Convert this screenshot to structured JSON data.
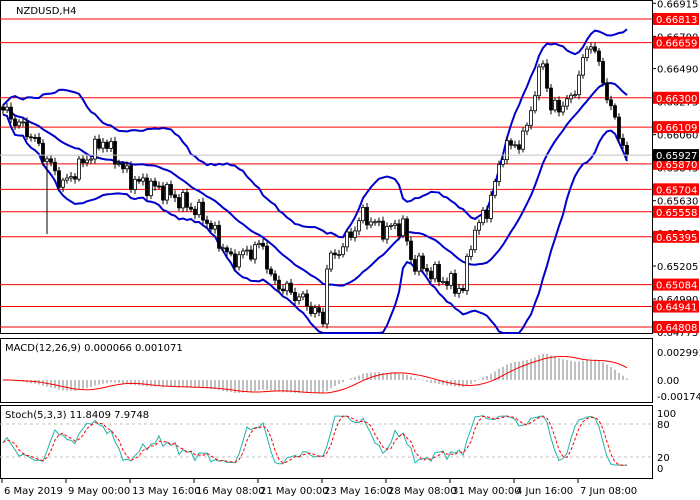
{
  "chart_data": {
    "type": "candlestick",
    "symbol_title": "NZDUSD,H4",
    "ylim": [
      0.64775,
      0.66915
    ],
    "y_ticks": [
      "0.66915",
      "0.66700",
      "0.66490",
      "0.66275",
      "0.66060",
      "0.65845",
      "0.65630",
      "0.65420",
      "0.65205",
      "0.64990",
      "0.64775"
    ],
    "levels": [
      "0.66813",
      "0.66659",
      "0.66300",
      "0.66109",
      "0.65870",
      "0.65704",
      "0.65558",
      "0.65395",
      "0.65084",
      "0.64941",
      "0.64808"
    ],
    "current_price": "0.65927",
    "x_labels": [
      "6 May 2019",
      "9 May 00:00",
      "13 May 16:00",
      "16 May 08:00",
      "21 May 00:00",
      "23 May 16:00",
      "28 May 08:00",
      "31 May 00:00",
      "4 Jun 16:00",
      "7 Jun 08:00"
    ],
    "x_label_bar_step": 16,
    "path_keypoints": [
      [
        0,
        0.66221
      ],
      [
        7,
        0.66058
      ],
      [
        15,
        0.65732
      ],
      [
        25,
        0.66025
      ],
      [
        32,
        0.65765
      ],
      [
        40,
        0.657
      ],
      [
        50,
        0.65537
      ],
      [
        57,
        0.65244
      ],
      [
        65,
        0.65342
      ],
      [
        67,
        0.65114
      ],
      [
        75,
        0.64984
      ],
      [
        80,
        0.64854
      ],
      [
        81,
        0.65212
      ],
      [
        86,
        0.65374
      ],
      [
        90,
        0.65537
      ],
      [
        95,
        0.6544
      ],
      [
        100,
        0.65472
      ],
      [
        102,
        0.65244
      ],
      [
        110,
        0.65114
      ],
      [
        115,
        0.65049
      ],
      [
        117,
        0.65374
      ],
      [
        122,
        0.65635
      ],
      [
        125,
        0.6596
      ],
      [
        130,
        0.66025
      ],
      [
        135,
        0.66546
      ],
      [
        137,
        0.66221
      ],
      [
        142,
        0.66286
      ],
      [
        146,
        0.66611
      ],
      [
        147,
        0.66676
      ],
      [
        150,
        0.66416
      ],
      [
        152,
        0.66221
      ],
      [
        156,
        0.65927
      ]
    ],
    "bollinger": {
      "period": 20,
      "deviation": 2
    },
    "macd": {
      "label": "MACD(12,26,9) 0.000066 0.001071",
      "ticks": [
        "0.002991",
        "0.00",
        "-0.001743"
      ],
      "max": 0.002991,
      "min": -0.001743
    },
    "stoch": {
      "label": "Stoch(5,3,3) 11.8409 7.9748",
      "ticks": [
        "100",
        "80",
        "20",
        "0"
      ],
      "levels": [
        80,
        20
      ]
    },
    "colors": {
      "level": "#ff0000",
      "bands": "#0000cc",
      "hist": "#c0c0c0",
      "signal": "#ff0000",
      "stoch_main": "#20b2aa",
      "stoch_signal": "#ff0000"
    }
  }
}
